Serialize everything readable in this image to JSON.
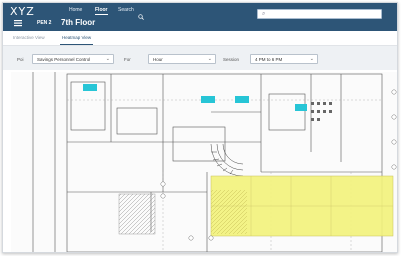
{
  "header": {
    "brand": "XYZ",
    "nav": [
      "Home",
      "Floor",
      "Search"
    ],
    "pen_label": "PEN 2",
    "floor_title": "7th Floor"
  },
  "tabs": [
    "Interactive View",
    "Heatmap View"
  ],
  "filters": {
    "poi_label": "Poi",
    "poi_value": "Savings Personnel Control",
    "for_label": "For",
    "for_value": "Hour",
    "session_label": "Session",
    "session_value": "4 PM to 6 PM"
  },
  "colors": {
    "header": "#2d5577",
    "highlight": "#f2f27a",
    "marker": "#27c5d6"
  }
}
